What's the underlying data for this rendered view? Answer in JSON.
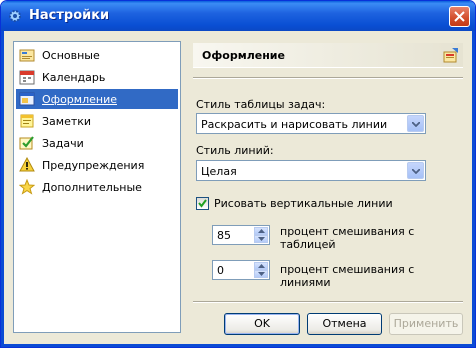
{
  "window": {
    "title": "Настройки"
  },
  "sidebar": {
    "items": [
      {
        "label": "Основные",
        "icon": "general-settings-icon"
      },
      {
        "label": "Календарь",
        "icon": "calendar-icon"
      },
      {
        "label": "Оформление",
        "icon": "appearance-icon",
        "selected": true
      },
      {
        "label": "Заметки",
        "icon": "notes-icon"
      },
      {
        "label": "Задачи",
        "icon": "tasks-icon"
      },
      {
        "label": "Предупреждения",
        "icon": "warning-icon"
      },
      {
        "label": "Дополнительные",
        "icon": "star-icon"
      }
    ]
  },
  "panel": {
    "title": "Оформление",
    "task_style_label": "Стиль таблицы задач:",
    "task_style_value": "Раскрасить и нарисовать линии",
    "line_style_label": "Стиль линий:",
    "line_style_value": "Целая",
    "draw_vertical_label": "Рисовать вертикальные линии",
    "draw_vertical_checked": true,
    "table_blend_value": "85",
    "table_blend_label_1": "процент смешивания с",
    "table_blend_label_2": "таблицей",
    "lines_blend_value": "0",
    "lines_blend_label_1": "процент смешивания с",
    "lines_blend_label_2": "линиями"
  },
  "buttons": {
    "ok": "OK",
    "cancel": "Отмена",
    "apply": "Применить"
  },
  "colors": {
    "titlebar": "#0a5fdc",
    "selection": "#316ac5",
    "dialog_bg": "#ece9d8"
  }
}
